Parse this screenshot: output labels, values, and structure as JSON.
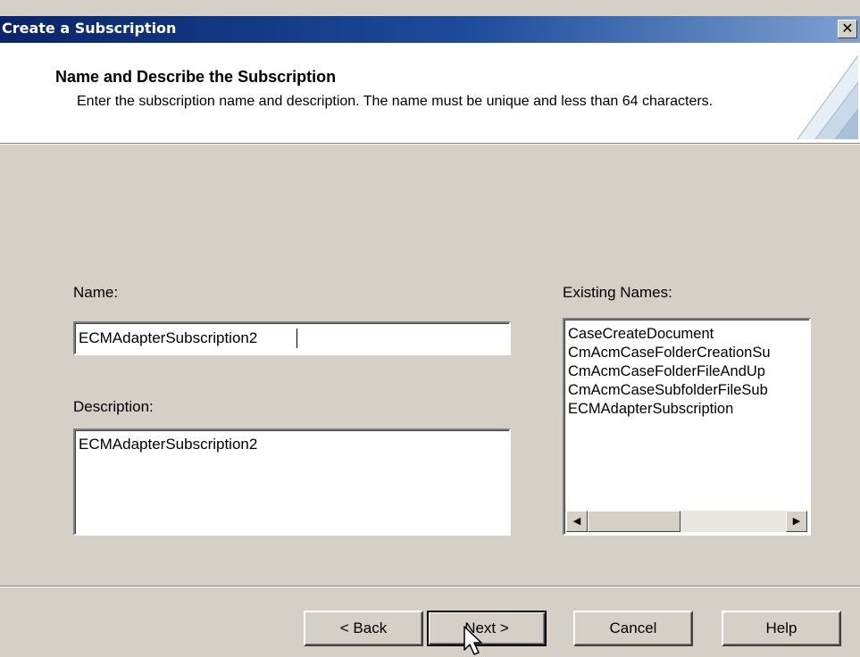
{
  "window": {
    "title": "Create a Subscription",
    "close_glyph": "✕"
  },
  "header": {
    "title": "Name and Describe the Subscription",
    "description": "Enter the subscription name and description. The name must be unique and less than 64 characters."
  },
  "form": {
    "name_label": "Name:",
    "name_value": "ECMAdapterSubscription2",
    "description_label": "Description:",
    "description_value": "ECMAdapterSubscription2"
  },
  "existing": {
    "label": "Existing Names:",
    "items": [
      "CaseCreateDocument",
      "CmAcmCaseFolderCreationSu",
      "CmAcmCaseFolderFileAndUp",
      "CmAcmCaseSubfolderFileSub",
      "ECMAdapterSubscription"
    ]
  },
  "buttons": {
    "back": "< Back",
    "next": "Next >",
    "cancel": "Cancel",
    "help": "Help"
  },
  "icons": {
    "close": "close-icon",
    "scroll_left": "scroll-left-arrow-icon",
    "scroll_right": "scroll-right-arrow-icon",
    "cursor": "mouse-pointer-icon",
    "wizard": "wizard-header-graphic"
  },
  "colors": {
    "titlebar_start": "#0a246a",
    "titlebar_end": "#7fa1d1",
    "dialog_face": "#d4d0c8"
  }
}
